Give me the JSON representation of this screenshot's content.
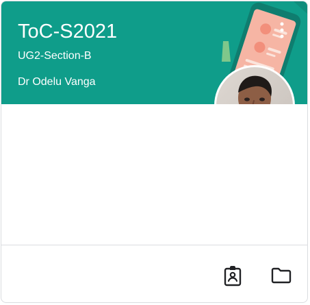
{
  "class_card": {
    "title": "ToC-S2021",
    "section": "UG2-Section-B",
    "teacher": "Dr Odelu Vanga"
  },
  "icons": {
    "more": "more-vert-icon",
    "avatar": "teacher-avatar",
    "assignment": "assignment-ind-icon",
    "folder": "folder-icon"
  },
  "colors": {
    "header_bg": "#0f9d8a",
    "footer_icons": "#202124"
  }
}
